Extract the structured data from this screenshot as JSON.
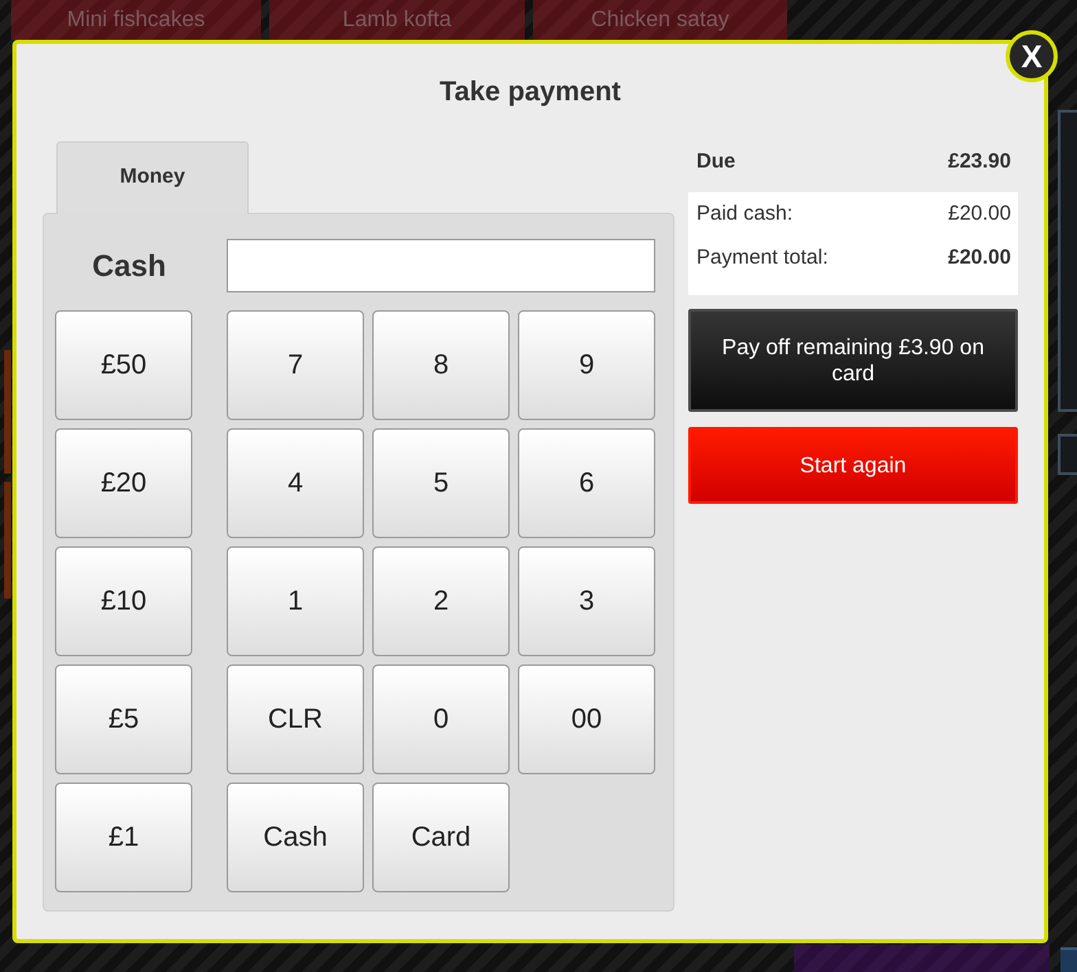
{
  "background_tiles": [
    {
      "label": "Mini fishcakes"
    },
    {
      "label": "Lamb kofta"
    },
    {
      "label": "Chicken satay"
    }
  ],
  "dialog": {
    "title": "Take payment",
    "close": "X"
  },
  "tabs": [
    {
      "label": "Money",
      "selected": true
    }
  ],
  "cash_field": {
    "label": "Cash"
  },
  "keypad": {
    "amount_keys": [
      "£50",
      "£20",
      "£10",
      "£5",
      "£1"
    ],
    "keys": [
      "7",
      "8",
      "9",
      "4",
      "5",
      "6",
      "1",
      "2",
      "3",
      "CLR",
      "0",
      "00",
      "Cash",
      "Card"
    ]
  },
  "summary": {
    "due": {
      "label": "Due",
      "value": "£23.90"
    },
    "rows": [
      {
        "label": "Paid cash:",
        "value": "£20.00",
        "kind": "normal"
      },
      {
        "label": "Payment total:",
        "value": "£20.00",
        "kind": "total"
      }
    ]
  },
  "actions": [
    {
      "label": "Pay off remaining £3.90 on card",
      "kind": "dark"
    },
    {
      "label": "Start again",
      "kind": "danger"
    }
  ]
}
